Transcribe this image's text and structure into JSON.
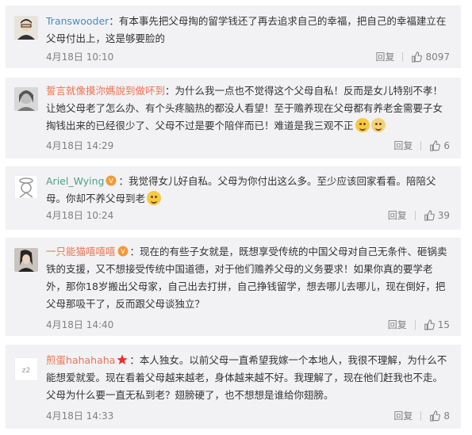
{
  "comments": [
    {
      "username": "Transwooder",
      "text": "：有本事先把父母掏的留学钱还了再去追求自己的幸福，把自己的幸福建立在父母付出上，这是够要脸的",
      "time": "4月18日 10:10",
      "reply": "回复",
      "likes": "8097"
    },
    {
      "username": "誓言就像摸沵媽說到做吥到",
      "text": "：为什么我一点也不觉得这个父母自私！反而是女儿特别不孝！让她父母老了怎么办、有个头疼脑热的都没人看望！至于赡养现在父母都有养老金需要子女掏钱出来的已经很少了、父母不过是要个陪伴而已！难道是我三观不正",
      "time": "4月18日 14:29",
      "reply": "回复",
      "likes": "6"
    },
    {
      "username": "Ariel_Wying",
      "text": "：我觉得女儿好自私。父母为你付出这么多。至少应该回家看看。陪陪父母。你却不养父母到老",
      "time": "4月18日 10:24",
      "reply": "回复",
      "likes": "39"
    },
    {
      "username": "一只能猫嘻嘻嘻",
      "text": "：现在的有些子女就是，既想享受传统的中国父母对自己无条件、砸锅卖铁的支援，又不想接受传统中国道德，对于他们赡养父母的义务要求！如果你真的要学老外，那你18岁搬出父母家，自己出去打拼，自己挣钱留学，想去哪儿去哪儿，现在倒好，把父母那吸干了，反而跟父母谈独立？",
      "time": "4月18日 14:40",
      "reply": "回复",
      "likes": "15"
    },
    {
      "username": "煎蛋hahahaha",
      "text": "：本人独女。以前父母一直希望我嫁一个本地人，我很不理解，为什么不能想爱就爱。现在看着父母越来越老，身体越来越不好。我理解了，现在他们赶我也不走。父母为什么要一直无私到老？翅膀硬了，也不想想是谁给你翅膀。",
      "time": "4月18日 14:33",
      "reply": "回复",
      "likes": "8"
    }
  ]
}
